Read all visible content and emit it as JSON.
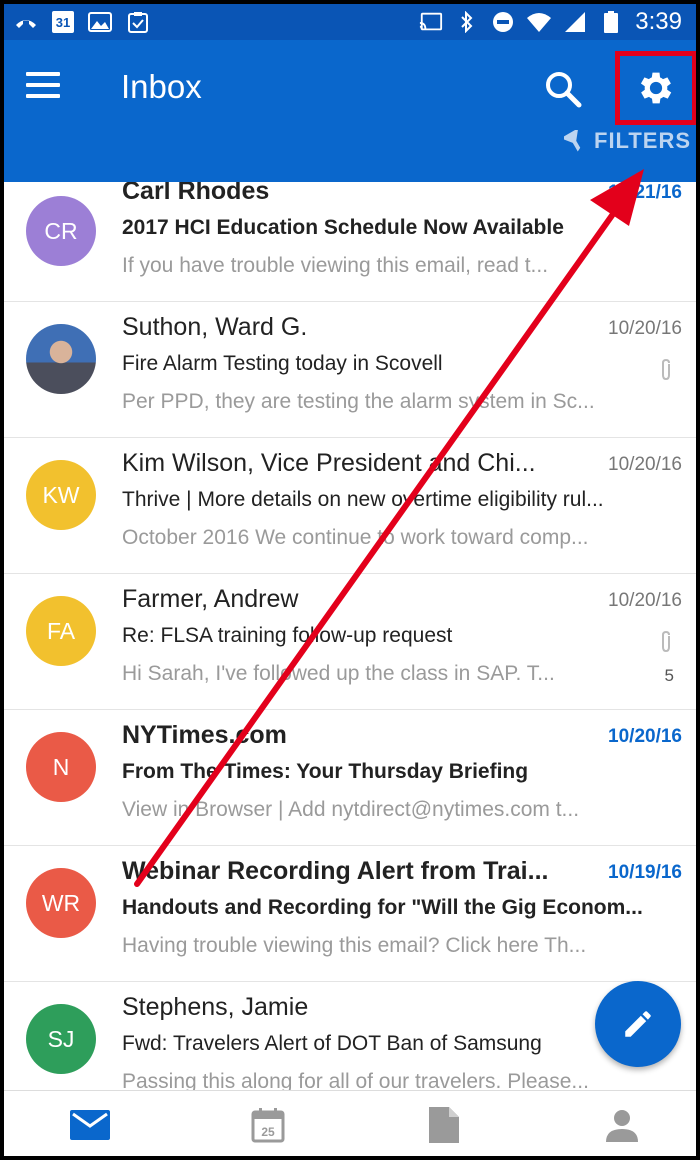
{
  "status_bar": {
    "calendar_day": "31",
    "time": "3:39",
    "icons": [
      "missed-call-icon",
      "calendar-icon",
      "image-icon",
      "clipboard-icon",
      "cast-icon",
      "bluetooth-icon",
      "do-not-disturb-icon",
      "wifi-icon",
      "signal-icon",
      "battery-icon"
    ]
  },
  "app_bar": {
    "title": "Inbox",
    "filters_label": "FILTERS",
    "icons": [
      "menu-icon",
      "search-icon",
      "gear-icon",
      "filter-icon"
    ]
  },
  "mails": [
    {
      "avatar": "CR",
      "color": "#9c7fd6",
      "sender": "Carl Rhodes",
      "date": "10/21/16",
      "subject": "2017 HCI Education Schedule Now Available",
      "preview": "If you have trouble viewing this email, read t...",
      "unread": true,
      "attachment": false,
      "count": ""
    },
    {
      "avatar": "",
      "color": "#4b6fb0",
      "sender": "Suthon, Ward G.",
      "date": "10/20/16",
      "subject": "Fire Alarm Testing today in Scovell",
      "preview": "Per PPD, they are testing the alarm system in Sc...",
      "unread": false,
      "attachment": true,
      "count": ""
    },
    {
      "avatar": "KW",
      "color": "#f2c12e",
      "sender": "Kim Wilson, Vice President and Chi...",
      "date": "10/20/16",
      "subject": "Thrive | More details on new overtime eligibility rul...",
      "preview": "October 2016 We continue to work toward comp...",
      "unread": false,
      "attachment": false,
      "count": ""
    },
    {
      "avatar": "FA",
      "color": "#f2c12e",
      "sender": "Farmer, Andrew",
      "date": "10/20/16",
      "subject": "Re: FLSA training follow-up request",
      "preview": "Hi Sarah, I've followed up the class in SAP. T...",
      "unread": false,
      "attachment": true,
      "count": "5"
    },
    {
      "avatar": "N",
      "color": "#ea5a47",
      "sender": "NYTimes.com",
      "date": "10/20/16",
      "subject": "From The Times: Your Thursday Briefing",
      "preview": "View in Browser | Add nytdirect@nytimes.com t...",
      "unread": true,
      "attachment": false,
      "count": ""
    },
    {
      "avatar": "WR",
      "color": "#ea5a47",
      "sender": "Webinar Recording Alert from Trai...",
      "date": "10/19/16",
      "subject": "Handouts and Recording for \"Will the Gig Econom...",
      "preview": "Having trouble viewing this email? Click here Th...",
      "unread": true,
      "attachment": false,
      "count": ""
    },
    {
      "avatar": "SJ",
      "color": "#2e9e5b",
      "sender": "Stephens, Jamie",
      "date": "",
      "subject": "Fwd: Travelers Alert of DOT Ban of Samsung",
      "preview": "Passing this along for all of our travelers. Please...",
      "unread": false,
      "attachment": false,
      "count": ""
    }
  ],
  "bottom_nav": {
    "calendar_day": "25",
    "icons": [
      "mail-icon",
      "calendar-icon",
      "files-icon",
      "people-icon"
    ]
  },
  "fab_icon": "pencil-icon",
  "colors": {
    "status_bar": "#0a55b5",
    "app_bar": "#0a67cc",
    "annotation": "#e3001b"
  }
}
